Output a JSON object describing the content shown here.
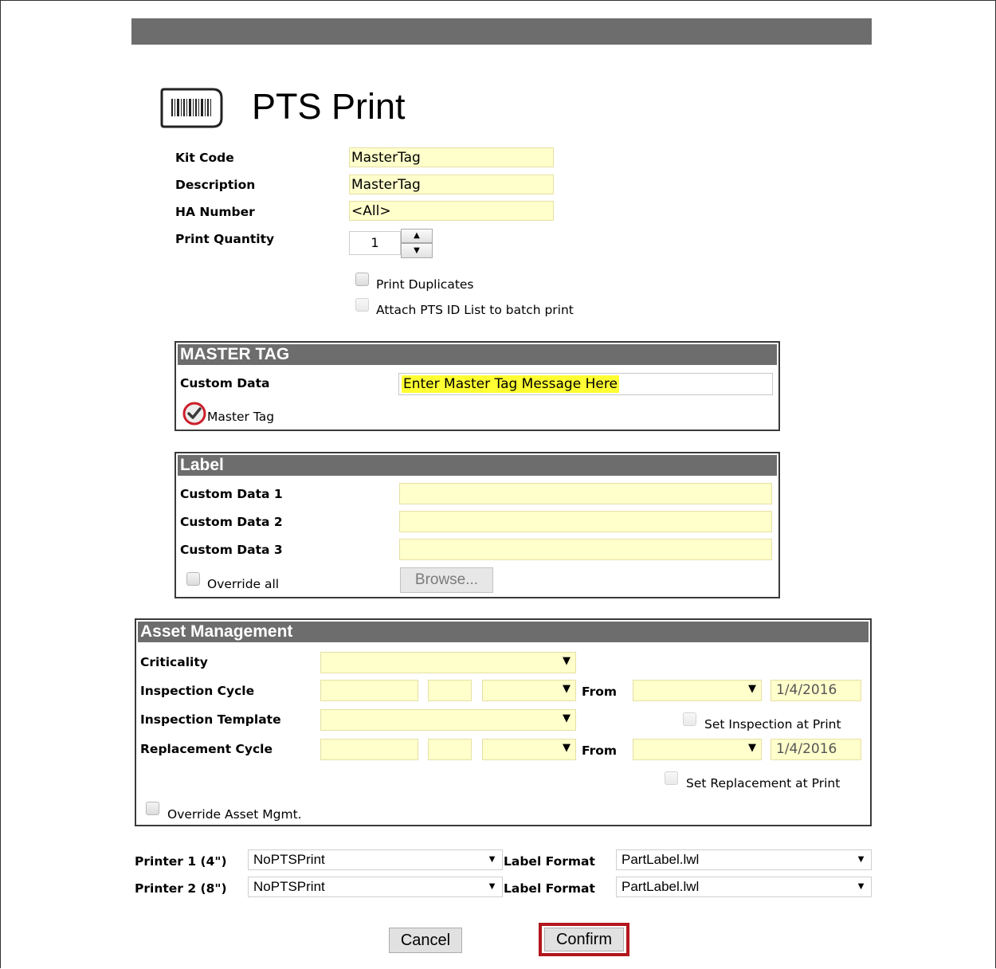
{
  "page": {
    "title": "PTS Print"
  },
  "form": {
    "kit_code_label": "Kit Code",
    "kit_code_value": "MasterTag",
    "description_label": "Description",
    "description_value": "MasterTag",
    "ha_number_label": "HA Number",
    "ha_number_value": "<All>",
    "print_quantity_label": "Print Quantity",
    "print_quantity_value": "1",
    "print_duplicates_label": "Print Duplicates",
    "attach_label": "Attach PTS ID List to batch print"
  },
  "master_tag": {
    "title": "MASTER TAG",
    "custom_data_label": "Custom Data",
    "custom_data_value": "Enter Master Tag Message Here",
    "master_tag_label": "Master Tag"
  },
  "label_panel": {
    "title": "Label",
    "custom_data_1_label": "Custom Data 1",
    "custom_data_2_label": "Custom Data 2",
    "custom_data_3_label": "Custom Data 3",
    "override_all_label": "Override all",
    "browse_label": "Browse..."
  },
  "asset": {
    "title": "Asset Management",
    "criticality_label": "Criticality",
    "inspection_cycle_label": "Inspection Cycle",
    "inspection_template_label": "Inspection Template",
    "replacement_cycle_label": "Replacement Cycle",
    "from_label": "From",
    "inspection_date": "1/4/2016",
    "replacement_date": "1/4/2016",
    "set_inspection_label": "Set Inspection at Print",
    "set_replacement_label": "Set Replacement at Print",
    "override_asset_label": "Override Asset Mgmt."
  },
  "printers": {
    "printer1_label": "Printer 1 (4\")",
    "printer1_value": "NoPTSPrint",
    "printer2_label": "Printer 2 (8\")",
    "printer2_value": "NoPTSPrint",
    "label_format_label": "Label Format",
    "format1_value": "PartLabel.lwl",
    "format2_value": "PartLabel.lwl"
  },
  "actions": {
    "cancel_label": "Cancel",
    "confirm_label": "Confirm"
  },
  "colors": {
    "field_yellow": "#ffffcc",
    "highlight_yellow": "#ffff33",
    "header_gray": "#6d6d6d",
    "confirm_border": "#b3161d"
  }
}
